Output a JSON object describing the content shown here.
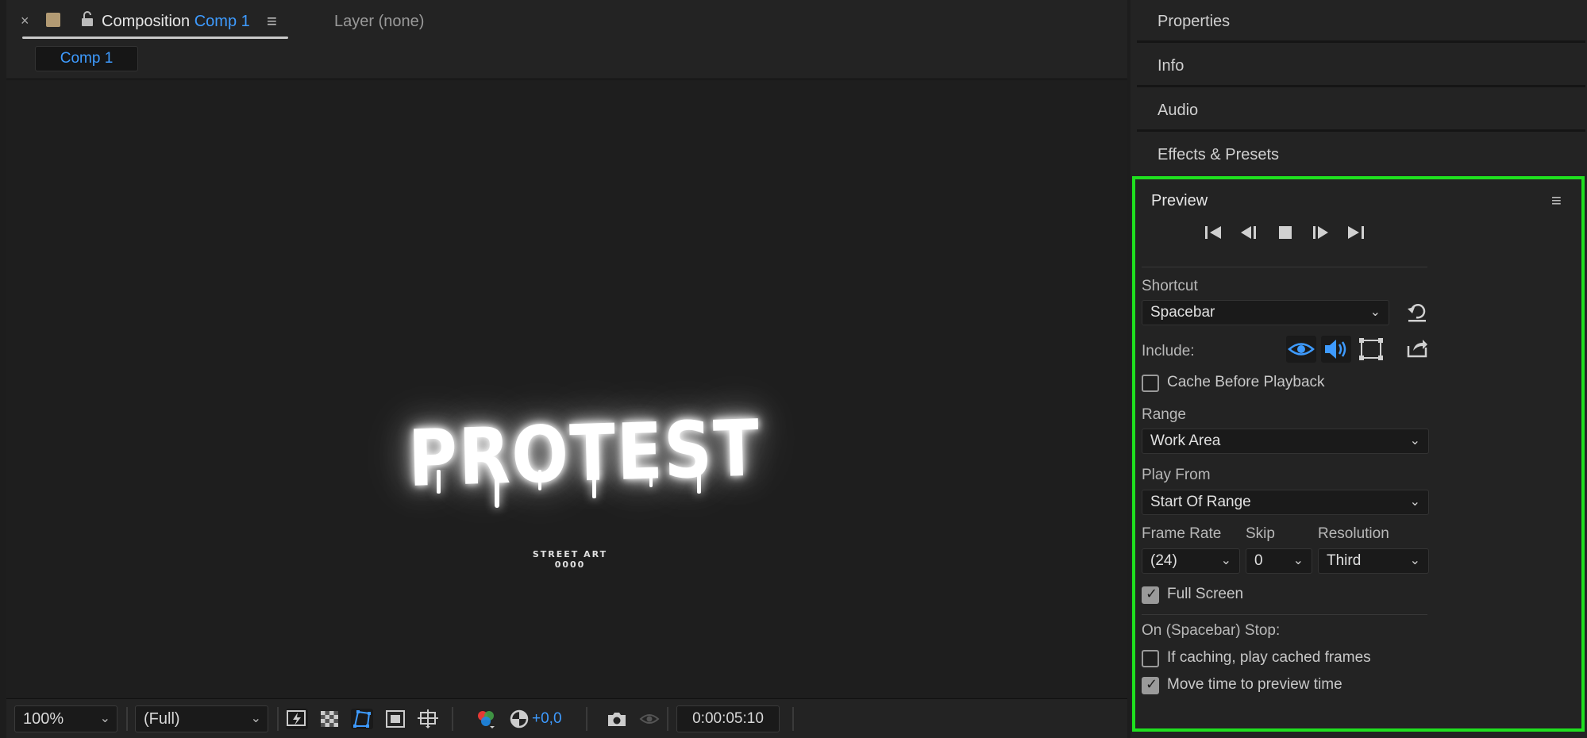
{
  "composition_tab": {
    "close_glyph": "×",
    "title_prefix": "Composition",
    "title_comp": "Comp 1",
    "menu_glyph": "≡",
    "layer_tab": "Layer (none)",
    "comp_chip": "Comp 1"
  },
  "viewer": {
    "title_text": "PROTEST",
    "subtitle_line1": "STREET ART",
    "subtitle_line2": "0000"
  },
  "bottom_toolbar": {
    "zoom": "100%",
    "resolution": "(Full)",
    "exposure": "+0,0",
    "timecode": "0:00:05:10",
    "icons": [
      "fast-previews-icon",
      "transparency-grid-icon",
      "mask-path-icon",
      "region-of-interest-icon",
      "grid-guides-icon",
      "color-channels-icon",
      "reset-exposure-icon",
      "snapshot-icon",
      "show-snapshot-icon"
    ]
  },
  "right_panels": {
    "properties": "Properties",
    "info": "Info",
    "audio": "Audio",
    "effects_presets": "Effects & Presets"
  },
  "preview": {
    "title": "Preview",
    "menu_glyph": "≡",
    "transport": [
      "first-frame-icon",
      "previous-frame-icon",
      "stop-icon",
      "next-frame-icon",
      "last-frame-icon"
    ],
    "shortcut_label": "Shortcut",
    "shortcut_value": "Spacebar",
    "include_label": "Include:",
    "cache_before_playback": "Cache Before Playback",
    "range_label": "Range",
    "range_value": "Work Area",
    "play_from_label": "Play From",
    "play_from_value": "Start Of Range",
    "frame_rate_label": "Frame Rate",
    "frame_rate_value": "(24)",
    "skip_label": "Skip",
    "skip_value": "0",
    "resolution_label": "Resolution",
    "resolution_value": "Third",
    "full_screen": "Full Screen",
    "stop_label": "On (Spacebar) Stop:",
    "if_caching": "If caching, play cached frames",
    "move_time": "Move time to preview time",
    "checks": {
      "cache_before_playback": false,
      "full_screen": true,
      "if_caching": false,
      "move_time": true
    },
    "accent_color": "#3e9bff",
    "highlight_color": "#1fe01f"
  }
}
